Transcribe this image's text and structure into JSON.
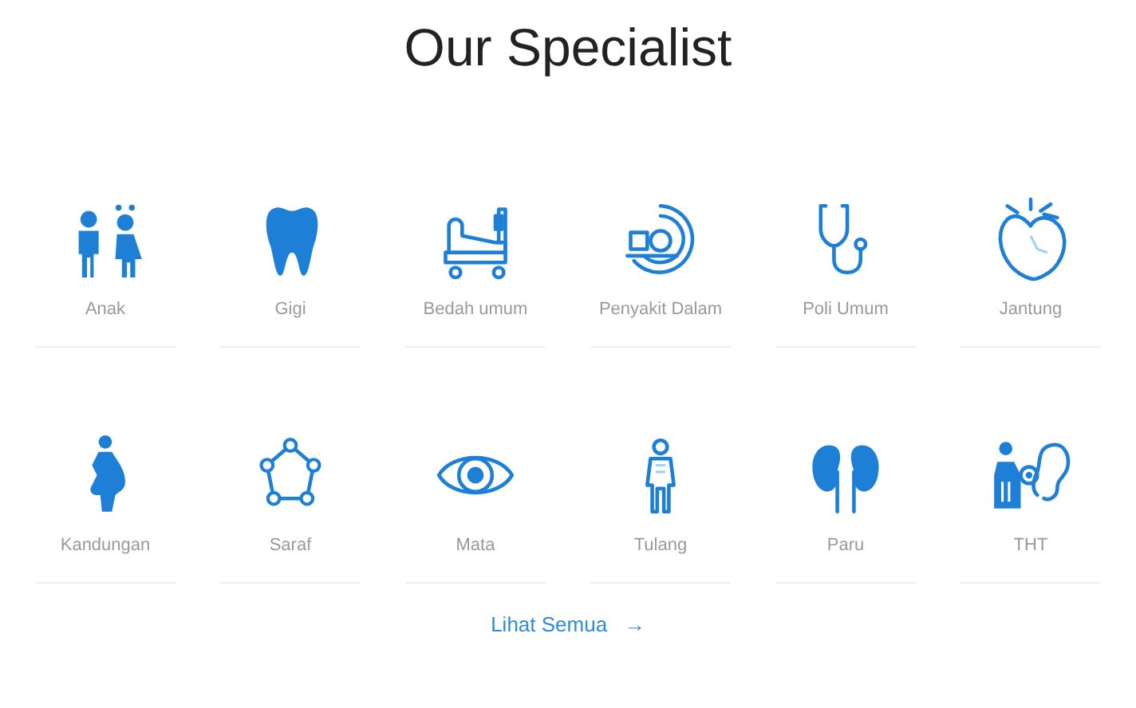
{
  "title": "Our Specialist",
  "specialists": [
    {
      "label": "Anak",
      "kind": "children"
    },
    {
      "label": "Gigi",
      "kind": "tooth"
    },
    {
      "label": "Bedah umum",
      "kind": "bed"
    },
    {
      "label": "Penyakit Dalam",
      "kind": "scanner"
    },
    {
      "label": "Poli Umum",
      "kind": "stethoscope"
    },
    {
      "label": "Jantung",
      "kind": "heart"
    },
    {
      "label": "Kandungan",
      "kind": "pregnant"
    },
    {
      "label": "Saraf",
      "kind": "network"
    },
    {
      "label": "Mata",
      "kind": "eye"
    },
    {
      "label": "Tulang",
      "kind": "skeleton"
    },
    {
      "label": "Paru",
      "kind": "kidneys"
    },
    {
      "label": "THT",
      "kind": "ear"
    }
  ],
  "link": {
    "label": "Lihat Semua",
    "arrow": "→"
  }
}
